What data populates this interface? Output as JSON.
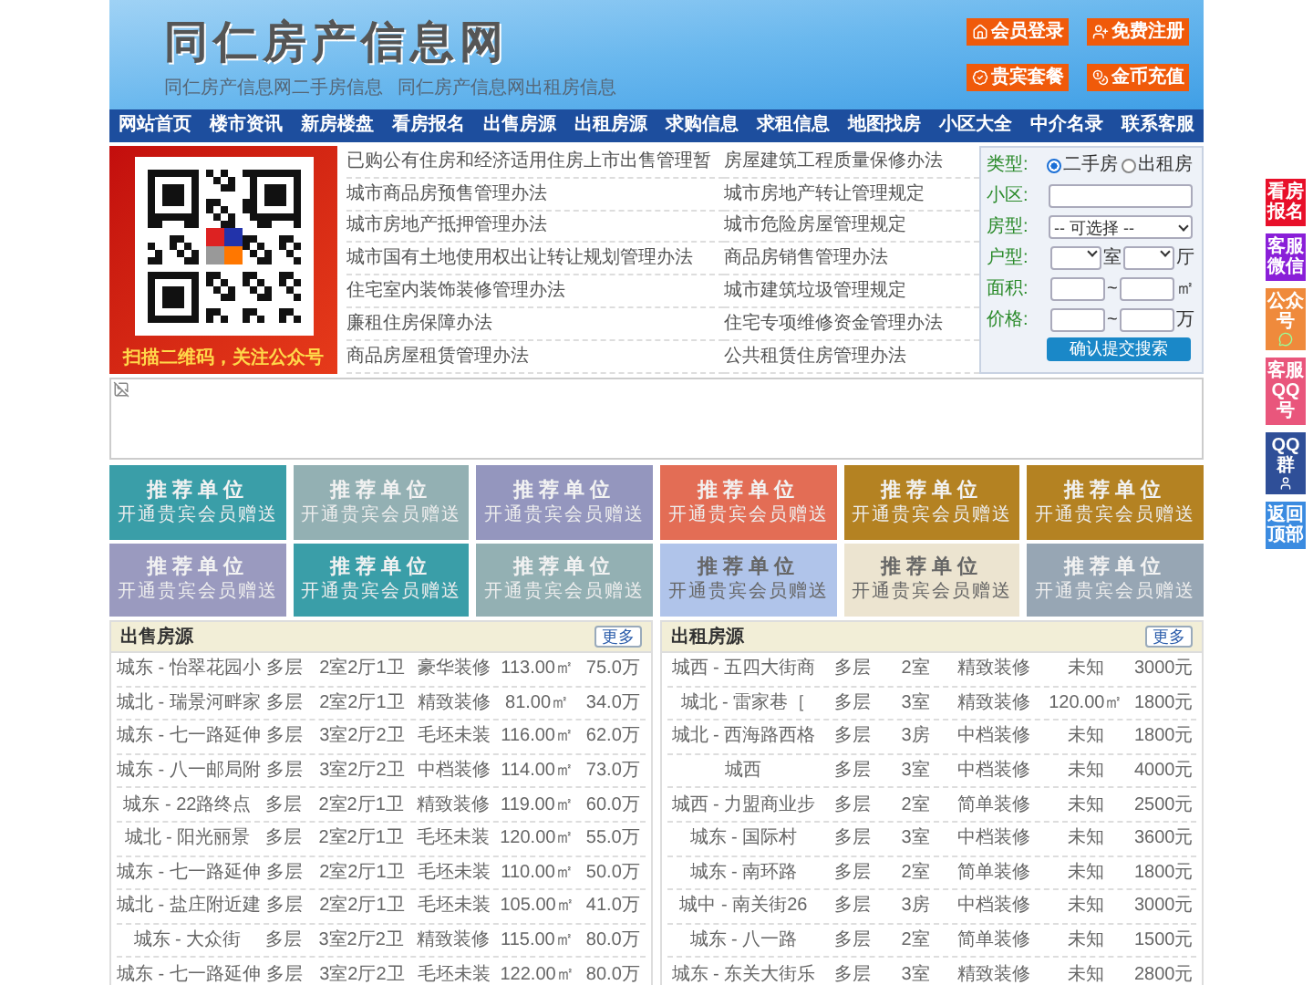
{
  "header": {
    "title": "同仁房产信息网",
    "subtitles": [
      "同仁房产信息网二手房信息",
      "同仁房产信息网出租房信息"
    ],
    "buttons": [
      {
        "label": "会员登录"
      },
      {
        "label": "免费注册"
      },
      {
        "label": "贵宾套餐"
      },
      {
        "label": "金币充值"
      }
    ]
  },
  "nav": [
    "网站首页",
    "楼市资讯",
    "新房楼盘",
    "看房报名",
    "出售房源",
    "出租房源",
    "求购信息",
    "求租信息",
    "地图找房",
    "小区大全",
    "中介名录",
    "联系客服"
  ],
  "qr": {
    "caption": "扫描二维码，关注公众号"
  },
  "links": [
    "已购公有住房和经济适用住房上市出售管理暂",
    "房屋建筑工程质量保修办法",
    "城市商品房预售管理办法",
    "城市房地产转让管理规定",
    "城市房地产抵押管理办法",
    "城市危险房屋管理规定",
    "城市国有土地使用权出让转让规划管理办法",
    "商品房销售管理办法",
    "住宅室内装饰装修管理办法",
    "城市建筑垃圾管理规定",
    "廉租住房保障办法",
    "住宅专项维修资金管理办法",
    "商品房屋租赁管理办法",
    "公共租赁住房管理办法"
  ],
  "search": {
    "type_label": "类型:",
    "options": [
      {
        "label": "二手房",
        "selected": true
      },
      {
        "label": "出租房",
        "selected": false
      }
    ],
    "community_label": "小区:",
    "house_type_label": "房型:",
    "house_type_value": "-- 可选择 --",
    "layout_label": "户型:",
    "room_unit": "室",
    "hall_unit": "厅",
    "area_label": "面积:",
    "area_sep": "~",
    "area_unit": "㎡",
    "price_label": "价格:",
    "price_sep": "~",
    "price_unit": "万",
    "submit": "确认提交搜索"
  },
  "promo_tiles": [
    {
      "title": "推荐单位",
      "subtitle": "开通贵宾会员赠送",
      "color": "#3a9ea8"
    },
    {
      "title": "推荐单位",
      "subtitle": "开通贵宾会员赠送",
      "color": "#93b0b3"
    },
    {
      "title": "推荐单位",
      "subtitle": "开通贵宾会员赠送",
      "color": "#9496be"
    },
    {
      "title": "推荐单位",
      "subtitle": "开通贵宾会员赠送",
      "color": "#e36d55"
    },
    {
      "title": "推荐单位",
      "subtitle": "开通贵宾会员赠送",
      "color": "#b48222"
    },
    {
      "title": "推荐单位",
      "subtitle": "开通贵宾会员赠送",
      "color": "#b48222"
    },
    {
      "title": "推荐单位",
      "subtitle": "开通贵宾会员赠送",
      "color": "#9a9abf"
    },
    {
      "title": "推荐单位",
      "subtitle": "开通贵宾会员赠送",
      "color": "#3a9ea8"
    },
    {
      "title": "推荐单位",
      "subtitle": "开通贵宾会员赠送",
      "color": "#93b0b3"
    },
    {
      "title": "推荐单位",
      "subtitle": "开通贵宾会员赠送",
      "color": "#b0c4ea"
    },
    {
      "title": "推荐单位",
      "subtitle": "开通贵宾会员赠送",
      "color": "#ece4d0"
    },
    {
      "title": "推荐单位",
      "subtitle": "开通贵宾会员赠送",
      "color": "#97a6b4"
    }
  ],
  "sale": {
    "title": "出售房源",
    "more": "更多",
    "rows": [
      [
        "城东 - 怡翠花园小",
        "多层",
        "2室2厅1卫",
        "豪华装修",
        "113.00㎡",
        "75.0万"
      ],
      [
        "城北 - 瑞景河畔家",
        "多层",
        "2室2厅1卫",
        "精致装修",
        "81.00㎡",
        "34.0万"
      ],
      [
        "城东 - 七一路延伸",
        "多层",
        "3室2厅2卫",
        "毛坯未装",
        "116.00㎡",
        "62.0万"
      ],
      [
        "城东 - 八一邮局附",
        "多层",
        "3室2厅2卫",
        "中档装修",
        "114.00㎡",
        "73.0万"
      ],
      [
        "城东 - 22路终点",
        "多层",
        "2室2厅1卫",
        "精致装修",
        "119.00㎡",
        "60.0万"
      ],
      [
        "城北 - 阳光丽景",
        "多层",
        "2室2厅1卫",
        "毛坯未装",
        "120.00㎡",
        "55.0万"
      ],
      [
        "城东 - 七一路延伸",
        "多层",
        "2室2厅1卫",
        "毛坯未装",
        "110.00㎡",
        "50.0万"
      ],
      [
        "城北 - 盐庄附近建",
        "多层",
        "2室2厅1卫",
        "毛坯未装",
        "105.00㎡",
        "41.0万"
      ],
      [
        "城东 - 大众街",
        "多层",
        "3室2厅2卫",
        "精致装修",
        "115.00㎡",
        "80.0万"
      ],
      [
        "城东 - 七一路延伸",
        "多层",
        "3室2厅2卫",
        "毛坯未装",
        "122.00㎡",
        "80.0万"
      ]
    ]
  },
  "rent": {
    "title": "出租房源",
    "more": "更多",
    "rows": [
      [
        "城西 - 五四大街商",
        "多层",
        "2室",
        "精致装修",
        "未知",
        "3000元"
      ],
      [
        "城北 - 雷家巷［",
        "多层",
        "3室",
        "精致装修",
        "120.00㎡",
        "1800元"
      ],
      [
        "城北 - 西海路西格",
        "多层",
        "3房",
        "中档装修",
        "未知",
        "1800元"
      ],
      [
        "城西",
        "多层",
        "3室",
        "中档装修",
        "未知",
        "4000元"
      ],
      [
        "城西 - 力盟商业步",
        "多层",
        "2室",
        "简单装修",
        "未知",
        "2500元"
      ],
      [
        "城东 - 国际村",
        "多层",
        "3室",
        "中档装修",
        "未知",
        "3600元"
      ],
      [
        "城东 - 南环路",
        "多层",
        "2室",
        "简单装修",
        "未知",
        "1800元"
      ],
      [
        "城中 - 南关街26",
        "多层",
        "3房",
        "中档装修",
        "未知",
        "3000元"
      ],
      [
        "城东 - 八一路",
        "多层",
        "2室",
        "简单装修",
        "未知",
        "1500元"
      ],
      [
        "城东 - 东关大街乐",
        "多层",
        "3室",
        "精致装修",
        "未知",
        "2800元"
      ]
    ]
  },
  "float_buttons": [
    {
      "label": "看房报名",
      "color": "#e8102a"
    },
    {
      "label": "客服微信",
      "color": "#8a1fd8"
    },
    {
      "label": "公众号",
      "color": "#ef8a3c"
    },
    {
      "label": "客服QQ号",
      "color": "#e9567c"
    },
    {
      "label": "QQ群",
      "color": "#2f4f98"
    },
    {
      "label": "返回顶部",
      "color": "#3b8be0"
    }
  ]
}
